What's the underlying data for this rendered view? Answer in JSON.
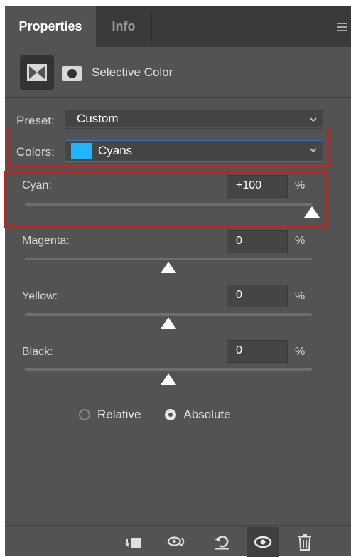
{
  "tabs": [
    {
      "label": "Properties",
      "active": true
    },
    {
      "label": "Info",
      "active": false
    }
  ],
  "header": {
    "title": "Selective Color",
    "icons": [
      "adjustment-layer-icon",
      "mask-icon"
    ]
  },
  "preset": {
    "label": "Preset:",
    "value": "Custom"
  },
  "colors": {
    "label": "Colors:",
    "value": "Cyans",
    "swatch_color": "#1fb6ff"
  },
  "sliders": [
    {
      "label": "Cyan:",
      "value": "+100",
      "unit": "%",
      "level_percent": 100
    },
    {
      "label": "Magenta:",
      "value": "0",
      "unit": "%",
      "level_percent": 0
    },
    {
      "label": "Yellow:",
      "value": "0",
      "unit": "%",
      "level_percent": 0
    },
    {
      "label": "Black:",
      "value": "0",
      "unit": "%",
      "level_percent": 0
    }
  ],
  "method": {
    "options": [
      {
        "label": "Relative",
        "selected": false
      },
      {
        "label": "Absolute",
        "selected": true
      }
    ]
  },
  "footer_icons": [
    "clip-to-layer-icon",
    "view-previous-state-icon",
    "reset-icon",
    "visibility-icon",
    "delete-icon"
  ],
  "highlight_color": "#cc1f1f"
}
